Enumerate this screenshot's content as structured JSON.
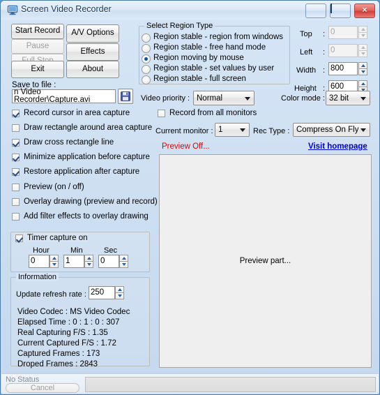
{
  "window": {
    "title": "Screen Video Recorder",
    "icon": "monitor-icon",
    "minimize_label": "",
    "maximize_label": "",
    "close_label": "×"
  },
  "actions": {
    "start_record": "Start Record",
    "pause": "Pause",
    "full_stop": "Full Stop",
    "exit": "Exit",
    "av_options": "A/V Options",
    "effects": "Effects",
    "about": "About",
    "pause_disabled": true,
    "full_stop_disabled": true
  },
  "save": {
    "label": "Save to file :",
    "value": "n Video Recorder\\Capture.avi",
    "button_icon": "floppy-disk-icon"
  },
  "region": {
    "group_title": "Select Region Type",
    "options": [
      {
        "label": "Region stable - region from windows",
        "selected": false
      },
      {
        "label": "Region stable - free hand mode",
        "selected": false
      },
      {
        "label": "Region moving by mouse",
        "selected": true
      },
      {
        "label": "Region stable - set values by user",
        "selected": false
      },
      {
        "label": "Region stable - full screen",
        "selected": false
      }
    ]
  },
  "bounds": [
    {
      "label": "Top",
      "separator": ":",
      "value": "0",
      "disabled": true
    },
    {
      "label": "Left",
      "separator": ":",
      "value": "0",
      "disabled": true
    },
    {
      "label": "Width",
      "separator": ":",
      "value": "800",
      "disabled": false
    },
    {
      "label": "Height",
      "separator": ":",
      "value": "600",
      "disabled": false
    }
  ],
  "video_priority": {
    "label": "Video priority :",
    "value": "Normal"
  },
  "color_mode": {
    "label": "Color mode :",
    "value": "32 bit"
  },
  "options": [
    {
      "label": "Record cursor in area capture",
      "checked": true
    },
    {
      "label": "Draw rectangle around area capture",
      "checked": false
    },
    {
      "label": "Draw cross rectangle line",
      "checked": true
    },
    {
      "label": "Minimize application before capture",
      "checked": true
    },
    {
      "label": "Restore application after capture",
      "checked": true
    },
    {
      "label": "Preview (on / off)",
      "checked": false
    },
    {
      "label": "Overlay drawing (preview and record)",
      "checked": false
    },
    {
      "label": "Add filter effects to overlay drawing",
      "checked": false
    }
  ],
  "monitors": {
    "all_monitors_label": "Record from all monitors",
    "all_monitors_checked": false,
    "current_monitor_label": "Current monitor :",
    "current_monitor_value": "1",
    "rec_type_label": "Rec Type :",
    "rec_type_value": "Compress On Fly"
  },
  "preview": {
    "status": "Preview Off...",
    "homepage_link": "Visit homepage",
    "body_text": "Preview part..."
  },
  "timer": {
    "enabled_label": "Timer capture on",
    "enabled": true,
    "fields": [
      {
        "label": "Hour",
        "value": "0"
      },
      {
        "label": "Min",
        "value": "1"
      },
      {
        "label": "Sec",
        "value": "0"
      }
    ]
  },
  "information": {
    "group_title": "Information",
    "refresh_label": "Update refresh rate :",
    "refresh_value": "250",
    "lines": [
      "Video Codec :  MS Video Codec",
      "Elapsed Time : 0 : 1 : 0 : 307",
      "Real Capturing F/S : 1.35",
      "Current Captured F/S :  1.72",
      "Captured Frames :  173",
      "Droped Frames : 2843"
    ]
  },
  "statusbar": {
    "status_text": "No Status",
    "cancel_label": "Cancel",
    "progress_percent": 0
  },
  "colors": {
    "accent": "#15508f",
    "link": "#0000cc",
    "alert": "#e00000",
    "titlebar_text": "#18365c"
  }
}
